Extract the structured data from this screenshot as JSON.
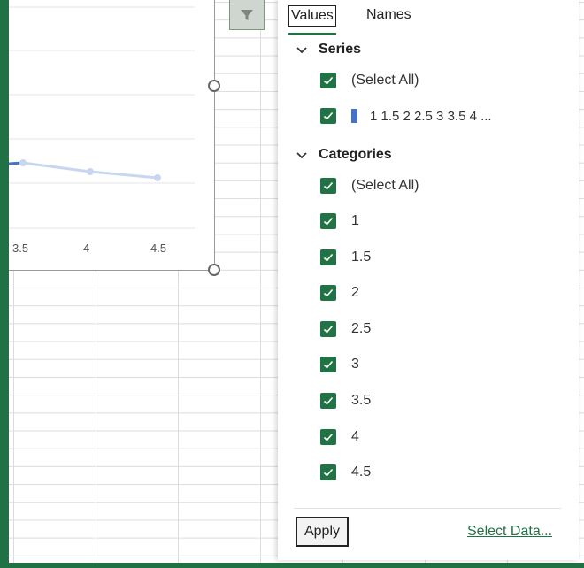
{
  "chart": {
    "x_tick_labels": [
      "3.5",
      "4",
      "4.5"
    ],
    "chart_data": {
      "type": "line",
      "x": [
        3.5,
        4,
        4.5
      ],
      "series": [
        {
          "values": [
            3.5,
            4,
            4.5
          ]
        }
      ]
    }
  },
  "icons": {
    "filter_button": "filter-funnel-icon",
    "checkbox": "checkmark-icon",
    "chevron": "chevron-down-icon"
  },
  "colors": {
    "accent": "#217346",
    "series": "#4472c4"
  },
  "filter_pane": {
    "tabs": {
      "values_label": "Values",
      "names_label": "Names"
    },
    "series_section": {
      "header": "Series",
      "select_all": "(Select All)",
      "items": [
        "1 1.5 2 2.5 3 3.5 4 ..."
      ]
    },
    "categories_section": {
      "header": "Categories",
      "select_all": "(Select All)",
      "items": [
        "1",
        "1.5",
        "2",
        "2.5",
        "3",
        "3.5",
        "4",
        "4.5"
      ]
    },
    "apply_label": "Apply",
    "select_data_label": "Select Data..."
  }
}
